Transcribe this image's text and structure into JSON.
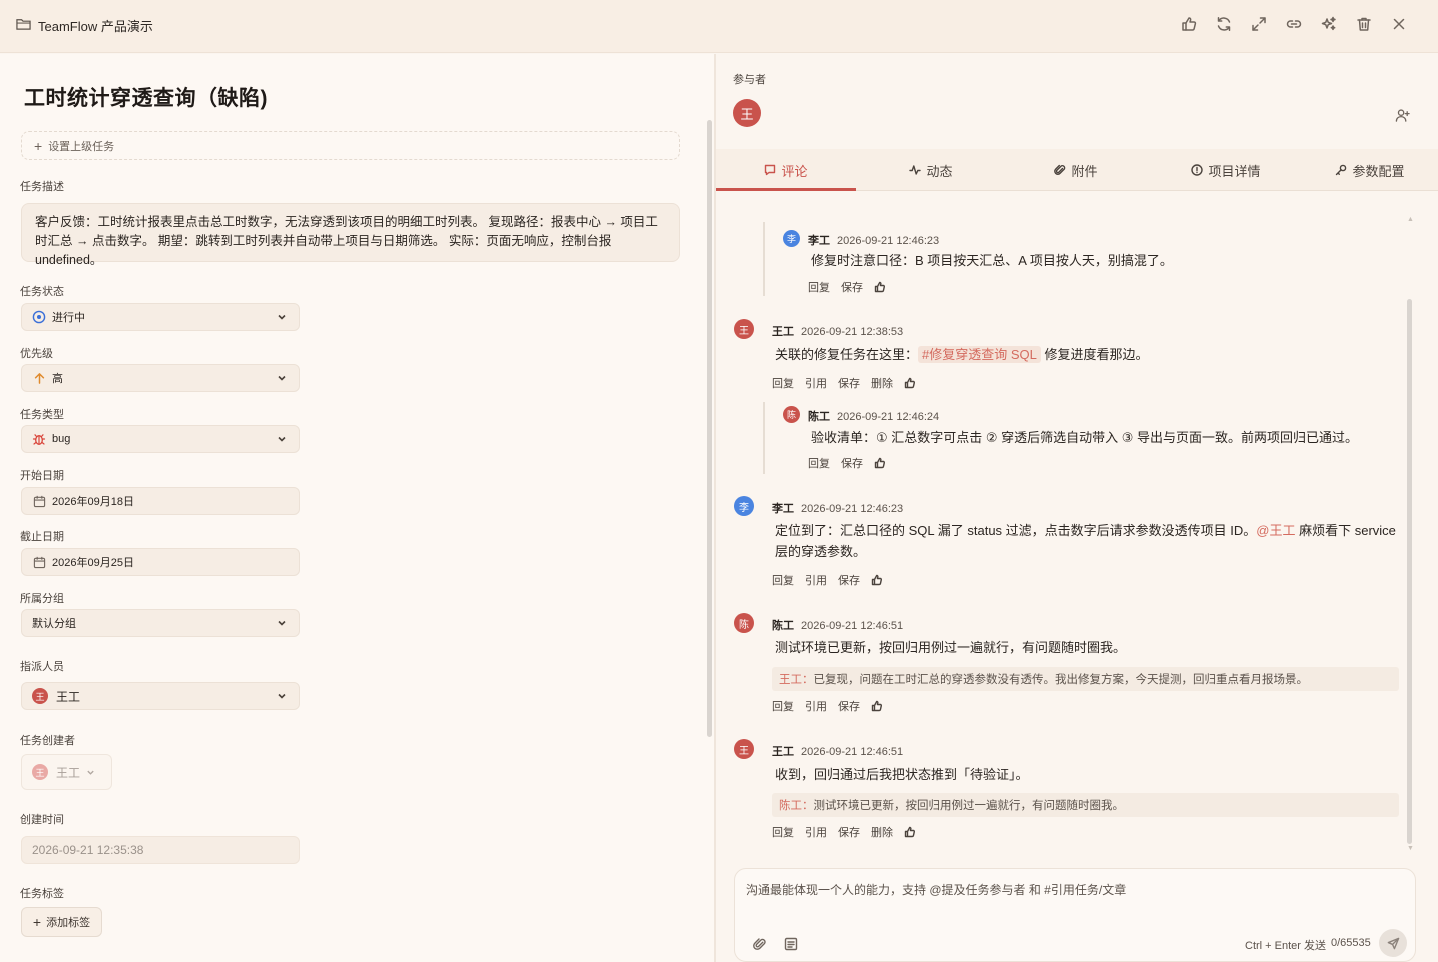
{
  "titlebar": {
    "title": "TeamFlow 产品演示",
    "icons": [
      "folder-icon",
      "thumbs-up-icon",
      "refresh-icon",
      "expand-icon",
      "link-icon",
      "sparkle-icon",
      "trash-icon",
      "close-icon"
    ]
  },
  "task": {
    "title": "工时统计穿透查询（缺陷)",
    "parent_task_label": "设置上级任务",
    "description_label": "任务描述",
    "description": "客户反馈：工时统计报表里点击总工时数字，无法穿透到该项目的明细工时列表。 复现路径：报表中心 → 项目工时汇总 → 点击数字。 期望：跳转到工时列表并自动带上项目与日期筛选。 实际：页面无响应，控制台报 undefined。",
    "status_label": "任务状态",
    "status_value": "进行中",
    "priority_label": "优先级",
    "priority_value": "高",
    "type_label": "任务类型",
    "type_value": "bug",
    "start_label": "开始日期",
    "start_value": "2026年09月18日",
    "due_label": "截止日期",
    "due_value": "2026年09月25日",
    "group_label": "所属分组",
    "group_value": "默认分组",
    "assignee_label": "指派人员",
    "assignee_value": "王工",
    "assignee_avatar": "王",
    "creator_label": "任务创建者",
    "creator_value": "王工",
    "creator_avatar": "王",
    "created_label": "创建时间",
    "created_value": "2026-09-21 12:35:38",
    "tags_label": "任务标签",
    "add_tag_label": "添加标签"
  },
  "right": {
    "participants_label": "参与者",
    "participant_avatar": "王",
    "tabs": [
      {
        "label": "评论",
        "icon": "comment-icon",
        "active": true
      },
      {
        "label": "动态",
        "icon": "activity-icon",
        "active": false
      },
      {
        "label": "附件",
        "icon": "paperclip-icon",
        "active": false
      },
      {
        "label": "项目详情",
        "icon": "info-icon",
        "active": false
      },
      {
        "label": "参数配置",
        "icon": "key-icon",
        "active": false
      }
    ],
    "accent_color": "#c9534c"
  },
  "comments": [
    {
      "avatar": "李",
      "author": "李工",
      "time": "2026-09-21 12:46:23",
      "text": "修复时注意口径：B 项目按天汇总、A 项目按人天，别搞混了。",
      "actions": [
        "回复",
        "保存"
      ]
    },
    {
      "avatar": "王",
      "author": "王工",
      "time": "2026-09-21 12:38:53",
      "text_before": "关联的修复任务在这里：",
      "link": "#修复穿透查询 SQL",
      "text_after": " 修复进度看那边。",
      "actions": [
        "回复",
        "引用",
        "保存",
        "删除"
      ]
    },
    {
      "avatar": "陈",
      "author": "陈工",
      "time": "2026-09-21 12:46:24",
      "text": "验收清单：① 汇总数字可点击 ② 穿透后筛选自动带入 ③ 导出与页面一致。前两项回归已通过。",
      "actions": [
        "回复",
        "保存"
      ]
    },
    {
      "avatar": "李",
      "author": "李工",
      "time": "2026-09-21 12:46:23",
      "text_line1_before": "定位到了：汇总口径的 SQL 漏了 status 过滤，点击数字后请求参数没透传项目 ID。",
      "mention": "@王工",
      "text_line1_after": " 麻烦看下 service",
      "text_line2": "层的穿透参数。",
      "actions": [
        "回复",
        "引用",
        "保存"
      ]
    },
    {
      "avatar": "陈",
      "author": "陈工",
      "time": "2026-09-21 12:46:51",
      "text": "测试环境已更新，按回归用例过一遍就行，有问题随时圈我。",
      "quote_author": "王工：",
      "quote_text": "已复现，问题在工时汇总的穿透参数没有透传。我出修复方案，今天提测，回归重点看月报场景。",
      "actions": [
        "回复",
        "引用",
        "保存"
      ]
    },
    {
      "avatar": "王",
      "author": "王工",
      "time": "2026-09-21 12:46:51",
      "text": "收到，回归通过后我把状态推到「待验证」。",
      "quote_author": "陈工：",
      "quote_text": "测试环境已更新，按回归用例过一遍就行，有问题随时圈我。",
      "actions": [
        "回复",
        "引用",
        "保存",
        "删除"
      ]
    }
  ],
  "composer": {
    "placeholder": "沟通最能体现一个人的能力，支持 @提及任务参与者 和 #引用任务/文章",
    "hint": "Ctrl + Enter 发送",
    "count": "0/65535"
  }
}
